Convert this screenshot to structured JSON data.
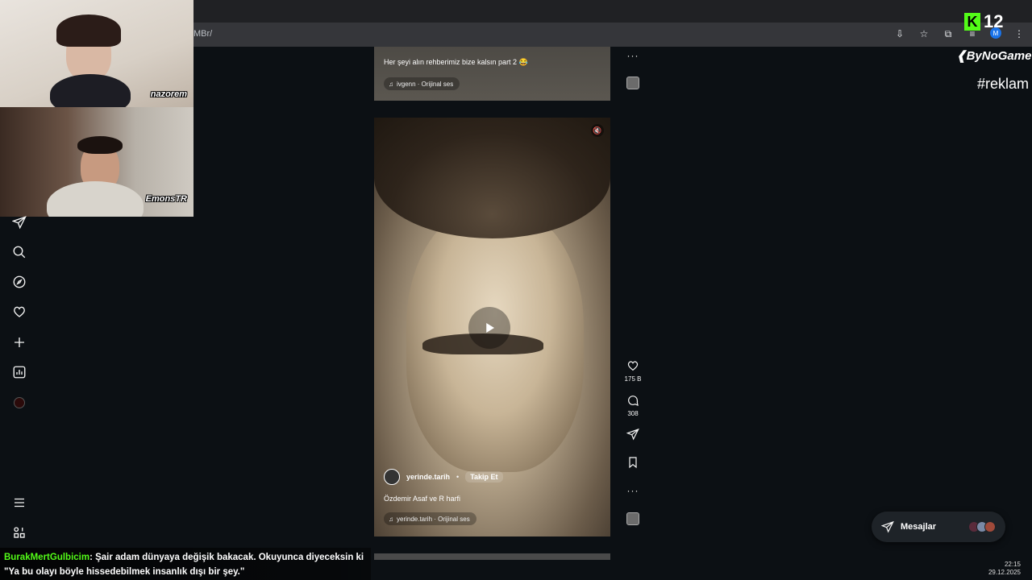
{
  "browser": {
    "url_fragment": "MBr/"
  },
  "streamers": {
    "cam1_name": "nazorem",
    "cam2_name": "EmonsTR"
  },
  "stream_overlay": {
    "kick_count": "12",
    "sponsor": "ByNoGame",
    "hashtag": "#reklam"
  },
  "feed": {
    "top_post": {
      "caption": "Her şeyi alın rehberimiz bize kalsın part 2 😂",
      "audio": "ivgenn · Orijinal ses"
    },
    "main_post": {
      "author": "yerinde.tarih",
      "separator": "•",
      "follow_label": "Takip Et",
      "caption": "Özdemir Asaf ve R harfi",
      "audio": "yerinde.tarih · Orijinal ses",
      "likes": "175 B",
      "comments": "308"
    }
  },
  "messages": {
    "label": "Mesajlar"
  },
  "chat": {
    "user": "BurakMertGulbicim",
    "message": ": Şair adam dünyaya değişik bakacak. Okuyunca diyeceksin ki \"Ya bu olayı böyle hissedebilmek insanlık dışı bir şey.\""
  },
  "clock": {
    "time": "22:15",
    "date": "29.12.2025"
  },
  "colors": {
    "page_bg": "#0c1014",
    "kick_green": "#53fc18"
  },
  "icons": [
    "direct-icon",
    "search-icon",
    "explore-icon",
    "heart-icon",
    "create-icon",
    "insights-icon",
    "menu-icon",
    "threads-icon",
    "comment-icon",
    "share-icon",
    "bookmark-icon",
    "play-icon",
    "mute-icon"
  ]
}
